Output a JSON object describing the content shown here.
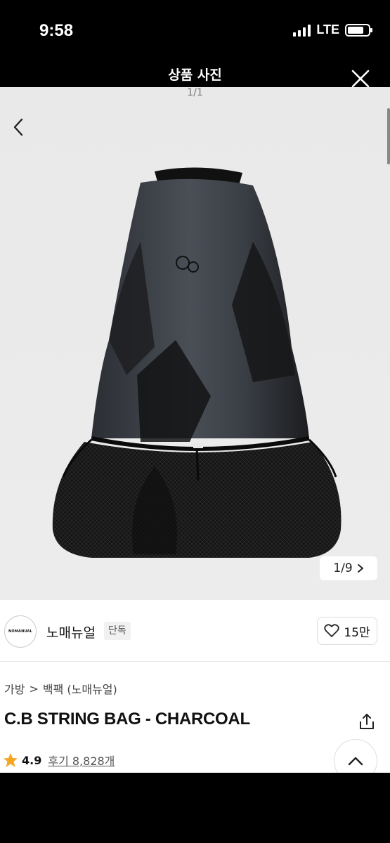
{
  "status_bar": {
    "time": "9:58",
    "network": "LTE",
    "battery_level": 0.8
  },
  "viewer": {
    "title": "상품 사진",
    "counter": "1/1"
  },
  "product_page": {
    "image_counter": "1/9",
    "store": {
      "logo_text": "NOMANUAL",
      "name": "노매뉴얼",
      "tag": "단독"
    },
    "like": {
      "count": "15만"
    },
    "breadcrumb": {
      "level1": "가방",
      "separator": ">",
      "level2": "백팩 (노매뉴얼)"
    },
    "title": "C.B STRING BAG - CHARCOAL",
    "rating": {
      "score": "4.9",
      "reviews": "후기 8,828개"
    }
  },
  "colors": {
    "accent_star": "#f5a623",
    "background": "#000000"
  }
}
